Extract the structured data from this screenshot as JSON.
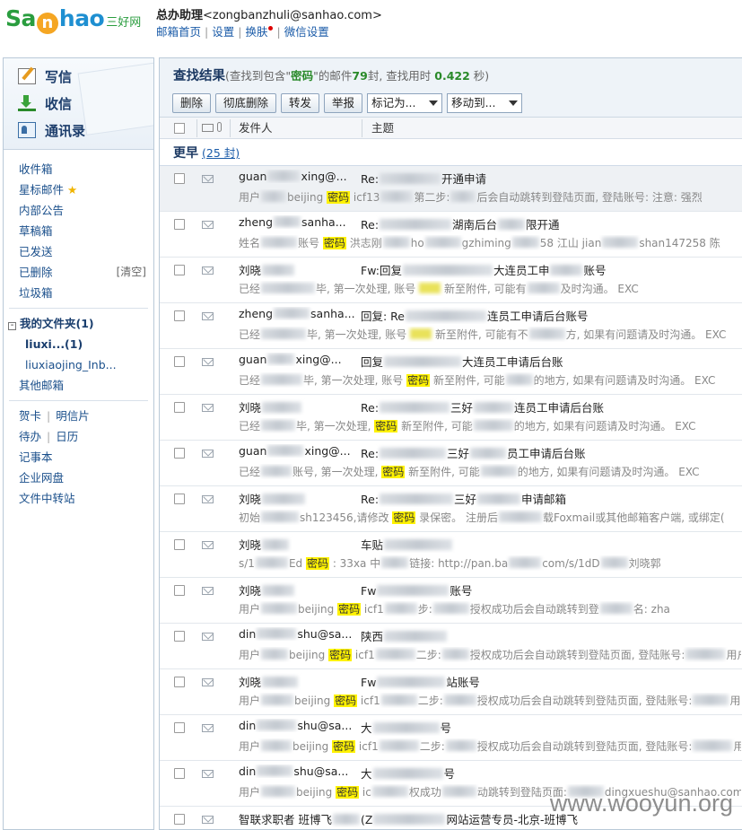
{
  "header": {
    "logo_text_a": "Sa",
    "logo_text_b": "n",
    "logo_text_c": "hao",
    "logo_cn": "三好网",
    "account_name": "总办助理",
    "account_email": "<zongbanzhuli@sanhao.com>",
    "links": [
      "邮箱首页",
      "设置",
      "换肤",
      "微信设置"
    ]
  },
  "sidebar": {
    "compose": "写信",
    "inbox": "收信",
    "contacts": "通讯录",
    "folders": [
      {
        "label": "收件箱",
        "name": "folder-inbox"
      },
      {
        "label": "星标邮件",
        "name": "folder-starred"
      },
      {
        "label": "内部公告",
        "name": "folder-announcements"
      },
      {
        "label": "草稿箱",
        "name": "folder-drafts"
      },
      {
        "label": "已发送",
        "name": "folder-sent"
      },
      {
        "label": "已删除",
        "name": "folder-deleted",
        "extra": "[清空]"
      },
      {
        "label": "垃圾箱",
        "name": "folder-spam"
      }
    ],
    "my_folders": "我的文件夹(1)",
    "my_folder_toggle": "-",
    "subfolder_bold": "liuxi...(1)",
    "subfolder": "liuxiaojing_Inb...",
    "other_mailbox": "其他邮箱",
    "tools": [
      {
        "a": "贺卡",
        "b": "明信片"
      },
      {
        "a": "待办",
        "b": "日历"
      }
    ],
    "notebook": "记事本",
    "netdisk": "企业网盘",
    "transfer": "文件中转站"
  },
  "main": {
    "title": "查找结果",
    "result_prefix": "(查找到包含\"",
    "keyword": "密码",
    "result_mid": "\"的邮件",
    "count": "79",
    "result_mid2": "封, 查找用时",
    "time": "0.422",
    "result_suffix": "秒)",
    "toolbar": {
      "delete": "删除",
      "purge": "彻底删除",
      "forward": "转发",
      "report": "举报",
      "mark_as": "标记为...",
      "move_to": "移动到..."
    },
    "columns": {
      "sender": "发件人",
      "subject": "主题"
    },
    "group_label": "更早",
    "group_count": "(25 封)",
    "rows": [
      {
        "sender": "guan",
        "sender2": "xing@...",
        "subject": "Re:",
        "subject2": "开通申请",
        "pre_a": "用户",
        "pre_b": "beijing",
        "pre_hl": "密码",
        "pre_c": "icf13",
        "pre_d": "第二步:",
        "pre_e": "后会自动跳转到登陆页面, 登陆账号: 注意: 强烈",
        "selected": true
      },
      {
        "sender": "zheng",
        "sender2": "sanha...",
        "subject": "Re:",
        "subject2": "湖南后台",
        "subject3": "限开通",
        "pre_a": "姓名",
        "pre_b": "账号",
        "pre_hl": "密码",
        "pre_c": "洪志刚",
        "pre_d": "ho",
        "pre_e": "gzhiming",
        "pre_f": "58 江山 jian",
        "pre_g": "shan147258 陈"
      },
      {
        "sender": "刘晓",
        "sender2": "",
        "subject": "Fw:回复",
        "subject2": "大连员工申",
        "subject3": "账号",
        "pre_a": "已经",
        "pre_b": "毕, 第一次处理, 账号",
        "pre_c": "新至附件, 可能有",
        "pre_e": "及时沟通。 EXC"
      },
      {
        "sender": "zheng",
        "sender2": "sanha...",
        "subject": "回复: Re",
        "subject2": "连员工申请后台账号",
        "pre_a": "已经",
        "pre_b": "毕, 第一次处理, 账号",
        "pre_c": "新至附件, 可能有不",
        "pre_e": "方, 如果有问题请及时沟通。 EXC"
      },
      {
        "sender": "guan",
        "sender2": "xing@...",
        "subject": "回复",
        "subject2": "大连员工申请后台账",
        "pre_a": "已经",
        "pre_b": "毕, 第一次处理, 账号",
        "pre_hl": "密码",
        "pre_c": "新至附件, 可能",
        "pre_e": "的地方, 如果有问题请及时沟通。 EXC"
      },
      {
        "sender": "刘晓",
        "sender2": "",
        "subject": "Re:",
        "subject2": "三好",
        "subject3": "连员工申请后台账",
        "pre_a": "已经",
        "pre_b": "毕, 第一次处理,",
        "pre_hl": "密码",
        "pre_c": "新至附件, 可能",
        "pre_e": "的地方, 如果有问题请及时沟通。 EXC"
      },
      {
        "sender": "guan",
        "sender2": "xing@...",
        "subject": "Re:",
        "subject2": "三好",
        "subject3": "员工申请后台账",
        "pre_a": "已经",
        "pre_b": "账号, 第一次处理,",
        "pre_hl": "密码",
        "pre_c": "新至附件, 可能",
        "pre_e": "的地方, 如果有问题请及时沟通。 EXC"
      },
      {
        "sender": "刘晓",
        "sender2": "",
        "subject": "Re:",
        "subject2": "三好",
        "subject3": "申请邮箱",
        "pre_a": "初始",
        "pre_b": "sh123456,请修改",
        "pre_hl": "密码",
        "pre_c": "录保密。 注册后",
        "pre_e": "载Foxmail或其他邮箱客户端, 或绑定("
      },
      {
        "sender": "刘晓",
        "sender2": "",
        "subject": "车贴",
        "subject2": "",
        "pre_a": "s/1",
        "pre_b": "Ed",
        "pre_hl": "密码",
        "pre_c": ": 33xa 中",
        "pre_d": "链接: http://pan.ba",
        "pre_e": "com/s/1dD",
        "pre_f": "刘晓郭"
      },
      {
        "sender": "刘晓",
        "sender2": "",
        "subject": "Fw",
        "subject2": "账号",
        "pre_a": "用户",
        "pre_b": "beijing",
        "pre_hl": "密码",
        "pre_c": "icf1",
        "pre_d": "步:",
        "pre_e": "授权成功后会自动跳转到登",
        "pre_f": "名: zha"
      },
      {
        "sender": "din",
        "sender2": "shu@sa...",
        "subject": "陕西",
        "subject2": "",
        "pre_a": "用户",
        "pre_b": "beijing",
        "pre_hl": "密码",
        "pre_c": "icf1",
        "pre_d": "二步:",
        "pre_e": "授权成功后会自动跳转到登陆页面, 登陆账号:",
        "pre_f": "用户名: zha"
      },
      {
        "sender": "刘晓",
        "sender2": "",
        "subject": "Fw",
        "subject2": "站账号",
        "pre_a": "用户",
        "pre_b": "beijing",
        "pre_hl": "密码",
        "pre_c": "icf1",
        "pre_d": "二步:",
        "pre_e": "授权成功后会自动跳转到登陆页面, 登陆账号:",
        "pre_f": "用户名: xia"
      },
      {
        "sender": "din",
        "sender2": "shu@sa...",
        "subject": "大",
        "subject2": "号",
        "pre_a": "用户",
        "pre_b": "beijing",
        "pre_hl": "密码",
        "pre_c": "icf1",
        "pre_d": "二步:",
        "pre_e": "授权成功后会自动跳转到登陆页面, 登陆账号:",
        "pre_f": "用户名: xia"
      },
      {
        "sender": "din",
        "sender2": "shu@sa...",
        "subject": "大",
        "subject2": "号",
        "pre_a": "用户",
        "pre_b": "beijing",
        "pre_hl": "密码",
        "pre_c": "ic",
        "pre_d": "权成功",
        "pre_e": "动跳转到登陆页面:",
        "pre_f": "dingxueshu@sanhao.com"
      },
      {
        "sender": "智联求职者 班博飞",
        "sender2": "",
        "subject": "(Z",
        "subject2": "网站运营专员-北京-班博飞",
        "pre_a": "",
        "pre_b": "",
        "pre_c": "",
        "pre_e": ""
      }
    ]
  },
  "watermark": "www.wooyun.org",
  "colors": {
    "accent": "#1d3a63",
    "highlight": "#fff200",
    "logo_green": "#2a9d3f",
    "logo_blue": "#1e8fd1"
  }
}
